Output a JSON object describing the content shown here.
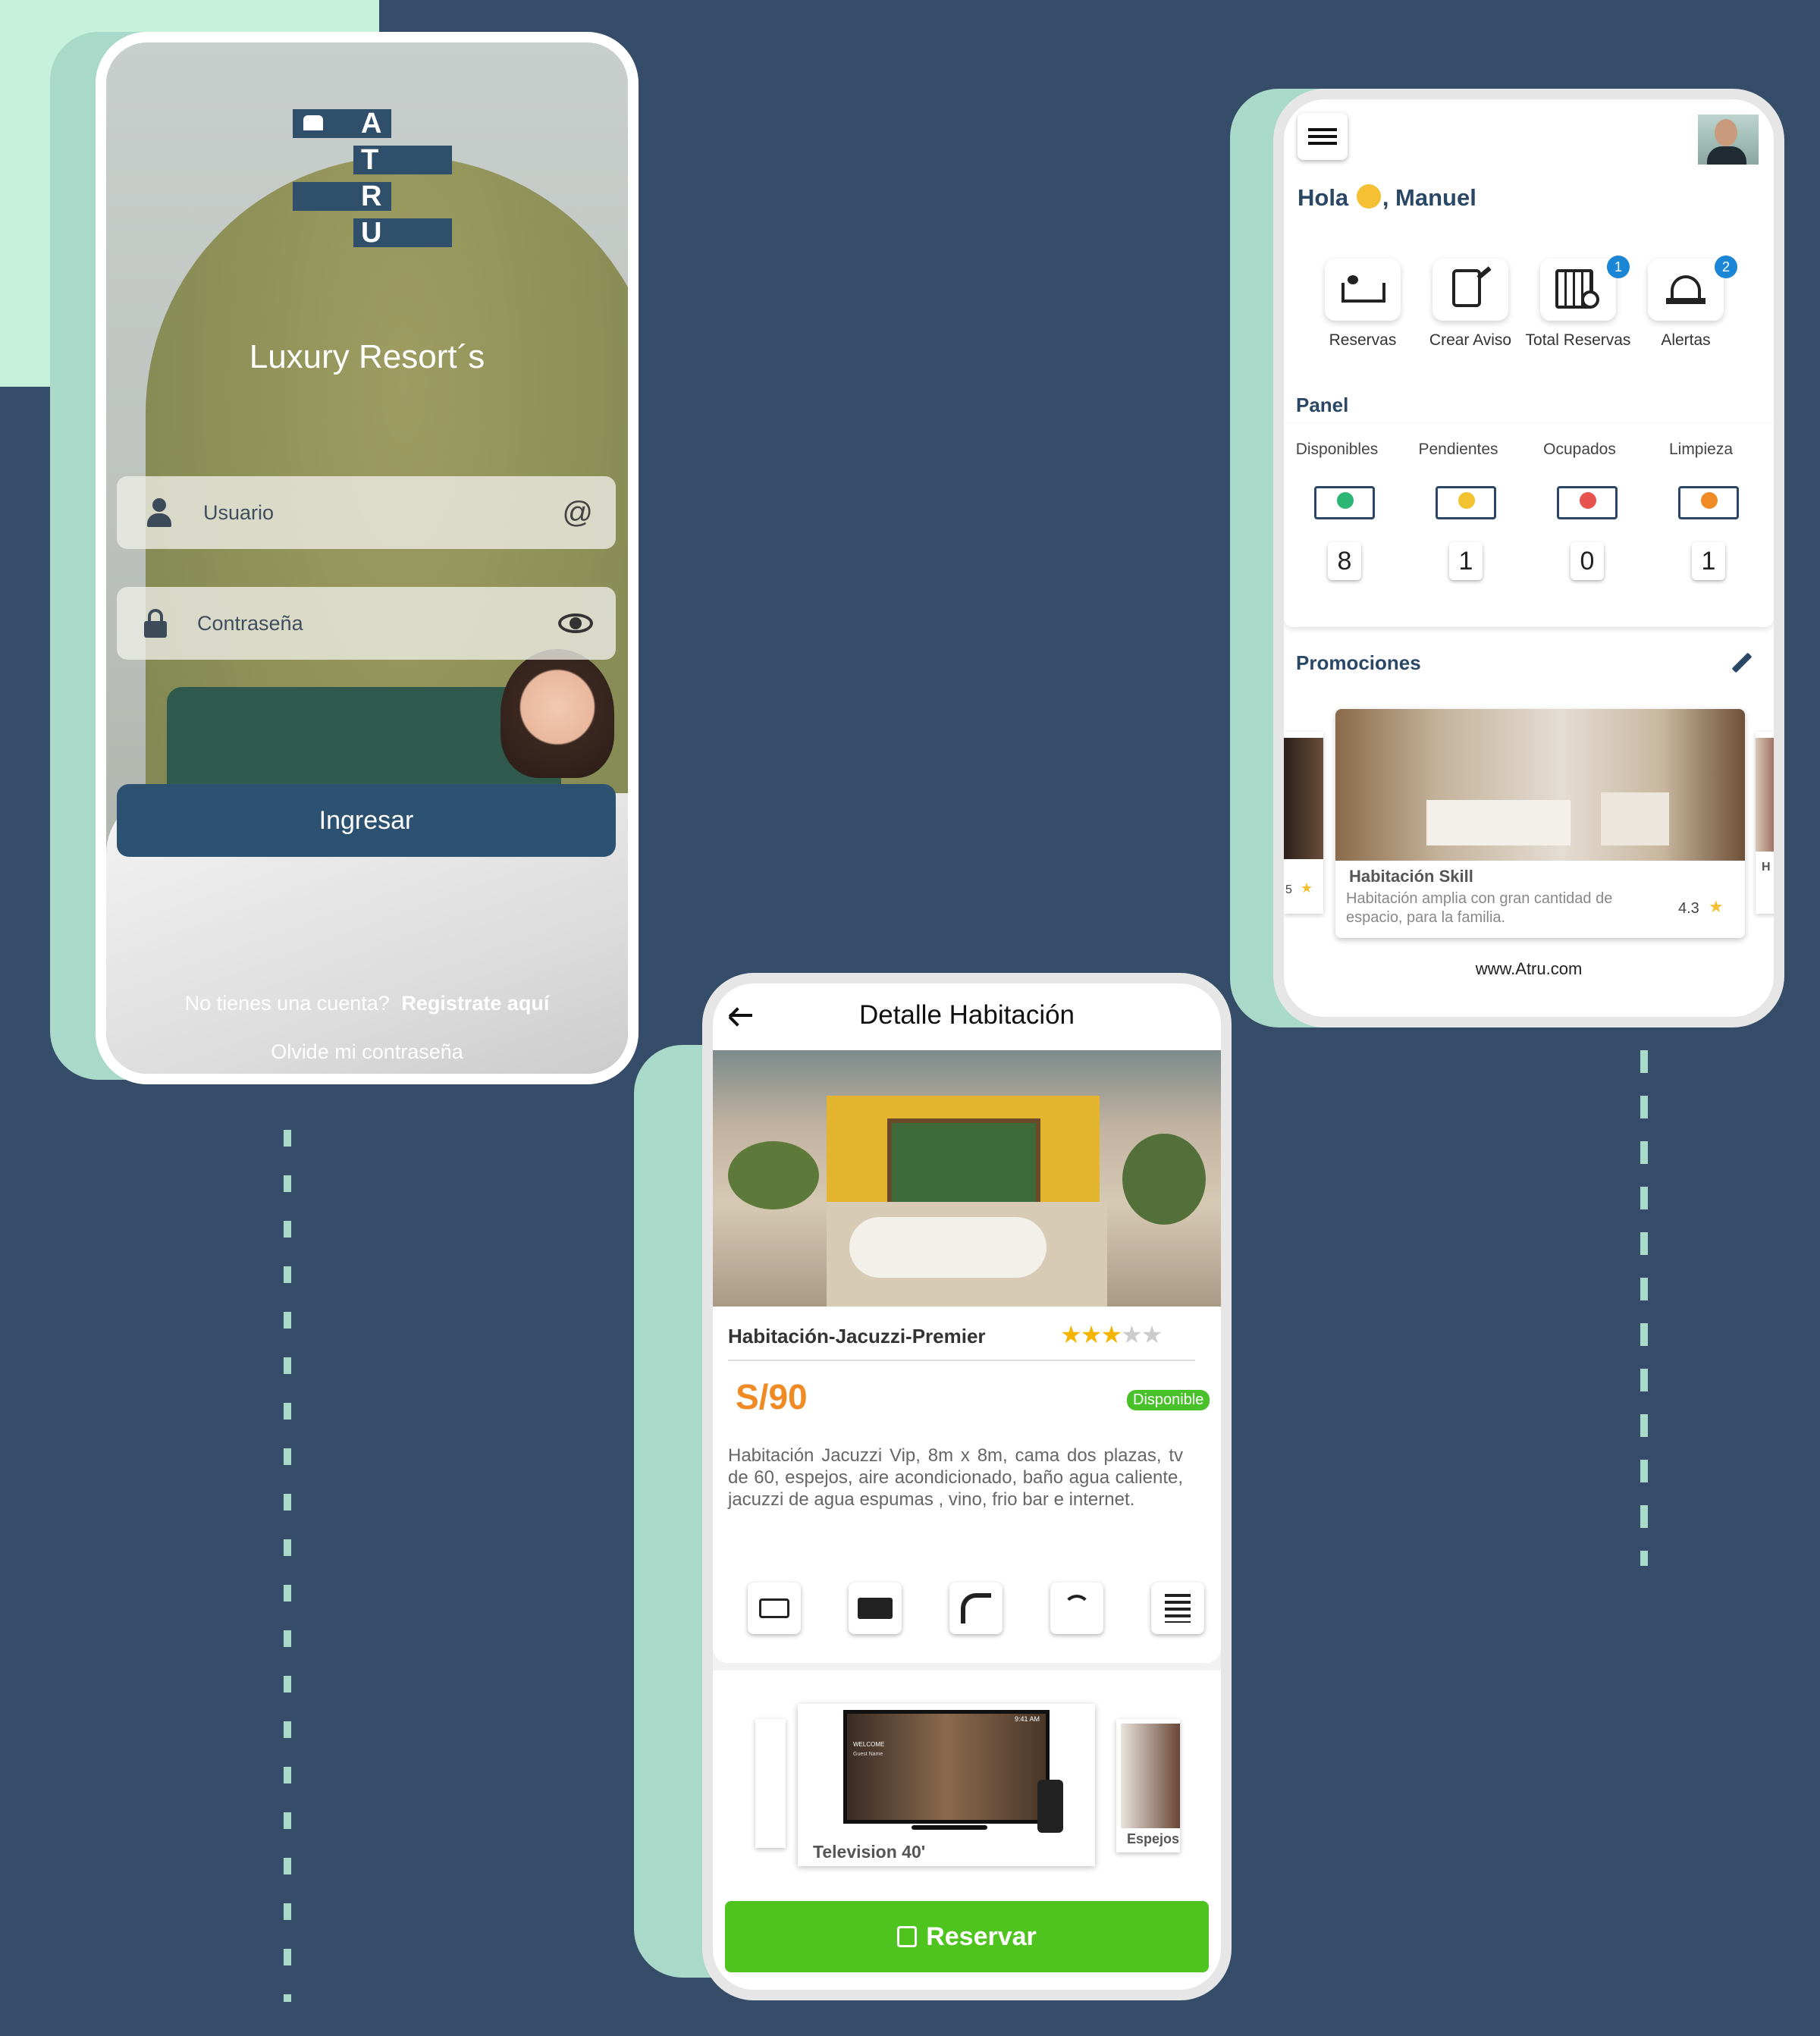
{
  "login": {
    "logo_letters": [
      "A",
      "T",
      "R",
      "U"
    ],
    "title": "Luxury Resort´s",
    "username_placeholder": "Usuario",
    "password_placeholder": "Contraseña",
    "login_button": "Ingresar",
    "no_account": "No tienes una cuenta?",
    "register_link": "Registrate aquí",
    "forgot_password": "Olvide mi contraseña"
  },
  "dashboard": {
    "greeting": "Hola",
    "user_name": ", Manuel",
    "quick_actions": [
      {
        "label": "Reservas",
        "icon": "bed-icon"
      },
      {
        "label": "Crear Aviso",
        "icon": "tablet-edit-icon"
      },
      {
        "label": "Total Reservas",
        "icon": "calendar-clock-icon",
        "badge": "1"
      },
      {
        "label": "Alertas",
        "icon": "alarm-icon",
        "badge": "2"
      }
    ],
    "panel_title": "Panel",
    "panel": [
      {
        "label": "Disponibles",
        "count": "8",
        "color": "#2bb673"
      },
      {
        "label": "Pendientes",
        "count": "1",
        "color": "#f2c230"
      },
      {
        "label": "Ocupados",
        "count": "0",
        "color": "#e8524f"
      },
      {
        "label": "Limpieza",
        "count": "1",
        "color": "#f08a24"
      }
    ],
    "promotions_title": "Promociones",
    "promo": {
      "title": "Habitación Skill",
      "description": "Habitación amplia con gran cantidad de espacio, para la familia.",
      "rating": "4.3",
      "side_left_rating": "5",
      "side_right_initial": "H"
    },
    "footer": "www.Atru.com"
  },
  "detail": {
    "title": "Detalle Habitación",
    "room_name": "Habitación-Jacuzzi-Premier",
    "stars": 3,
    "price": "S/90",
    "status": "Disponible",
    "description": "Habitación Jacuzzi Vip, 8m x 8m, cama dos plazas, tv de 60, espejos, aire acondicionado, baño agua caliente, jacuzzi de agua espumas , vino, frio bar e internet.",
    "amenities": [
      "bed-icon",
      "tv-icon",
      "shower-icon",
      "wifi-icon",
      "heater-icon"
    ],
    "gallery": [
      {
        "label": "Television 40'"
      },
      {
        "label": "Espejos"
      }
    ],
    "tv_text": [
      "WELCOME",
      "Guest Name"
    ],
    "tv_time": "9:41 AM",
    "reserve_button": "Reservar"
  },
  "colors": {
    "background": "#354d68",
    "accent_mint": "#a9d9c9",
    "primary": "#2d5170",
    "price_orange": "#f08a24",
    "status_green": "#49c12a",
    "reserve_green": "#4fc41f"
  }
}
